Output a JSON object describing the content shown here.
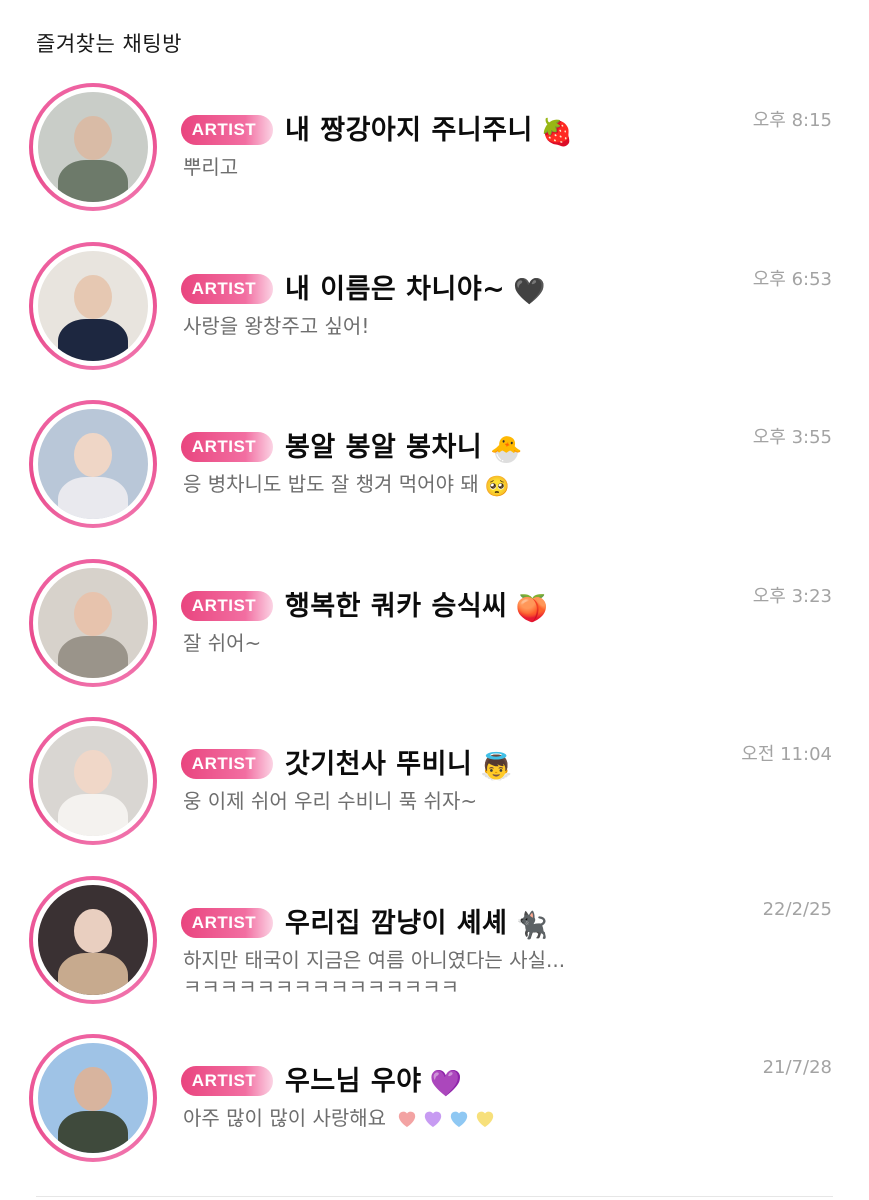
{
  "section": {
    "title": "즐겨찾는 채팅방"
  },
  "chats": [
    {
      "badge": "ARTIST",
      "name": "내 짱강아지 주니주니",
      "name_emoji": "🍓",
      "preview": "뿌리고",
      "preview_emoji": "",
      "time": "오후 8:15",
      "avatar_colors": {
        "bg": "#c9cdc8",
        "skin": "#d9bba6",
        "top": "#6d7a6a"
      }
    },
    {
      "badge": "ARTIST",
      "name": "내 이름은 차니야~",
      "name_emoji": "🖤",
      "preview": "사랑을 왕창주고 싶어!",
      "preview_emoji": "",
      "time": "오후 6:53",
      "avatar_colors": {
        "bg": "#e8e4de",
        "skin": "#e6c8b2",
        "top": "#1d2740"
      }
    },
    {
      "badge": "ARTIST",
      "name": "봉알 봉알 봉차니",
      "name_emoji": "🐣",
      "preview": "응 병차니도 밥도 잘 챙겨 먹어야 돼",
      "preview_emoji": "🥺",
      "time": "오후 3:55",
      "avatar_colors": {
        "bg": "#b9c7d8",
        "skin": "#efd6c6",
        "top": "#e9e9ee"
      }
    },
    {
      "badge": "ARTIST",
      "name": "행복한 쿼카 승식씨",
      "name_emoji": "🍑",
      "preview": "잘 쉬어~",
      "preview_emoji": "",
      "time": "오후 3:23",
      "avatar_colors": {
        "bg": "#d7d2cb",
        "skin": "#e7c3ad",
        "top": "#9a948a"
      }
    },
    {
      "badge": "ARTIST",
      "name": "갓기천사 뚜비니",
      "name_emoji": "👼",
      "preview": "웅 이제 쉬어 우리 수비니 푹 쉬자~",
      "preview_emoji": "",
      "time": "오전 11:04",
      "avatar_colors": {
        "bg": "#d9d6d2",
        "skin": "#f0d7c8",
        "top": "#f4f2ef"
      }
    },
    {
      "badge": "ARTIST",
      "name": "우리집 깜냥이 셰셰",
      "name_emoji": "🐈‍⬛",
      "preview": "하지만 태국이 지금은 여름 아니였다는 사실...\nㅋㅋㅋㅋㅋㅋㅋㅋㅋㅋㅋㅋㅋㅋㅋ",
      "preview_emoji": "",
      "time": "22/2/25",
      "avatar_colors": {
        "bg": "#3a3133",
        "skin": "#e9cfc0",
        "top": "#c7aa8e"
      }
    },
    {
      "badge": "ARTIST",
      "name": "우느님 우야",
      "name_emoji": "💜",
      "preview": "아주 많이 많이 사랑해요",
      "preview_emoji": "",
      "preview_hearts": [
        "#f3a3a3",
        "#c79bf2",
        "#8fc8f3",
        "#f7e07b"
      ],
      "time": "21/7/28",
      "avatar_colors": {
        "bg": "#9fc3e6",
        "skin": "#d8b49e",
        "top": "#3f4a3c"
      }
    }
  ]
}
